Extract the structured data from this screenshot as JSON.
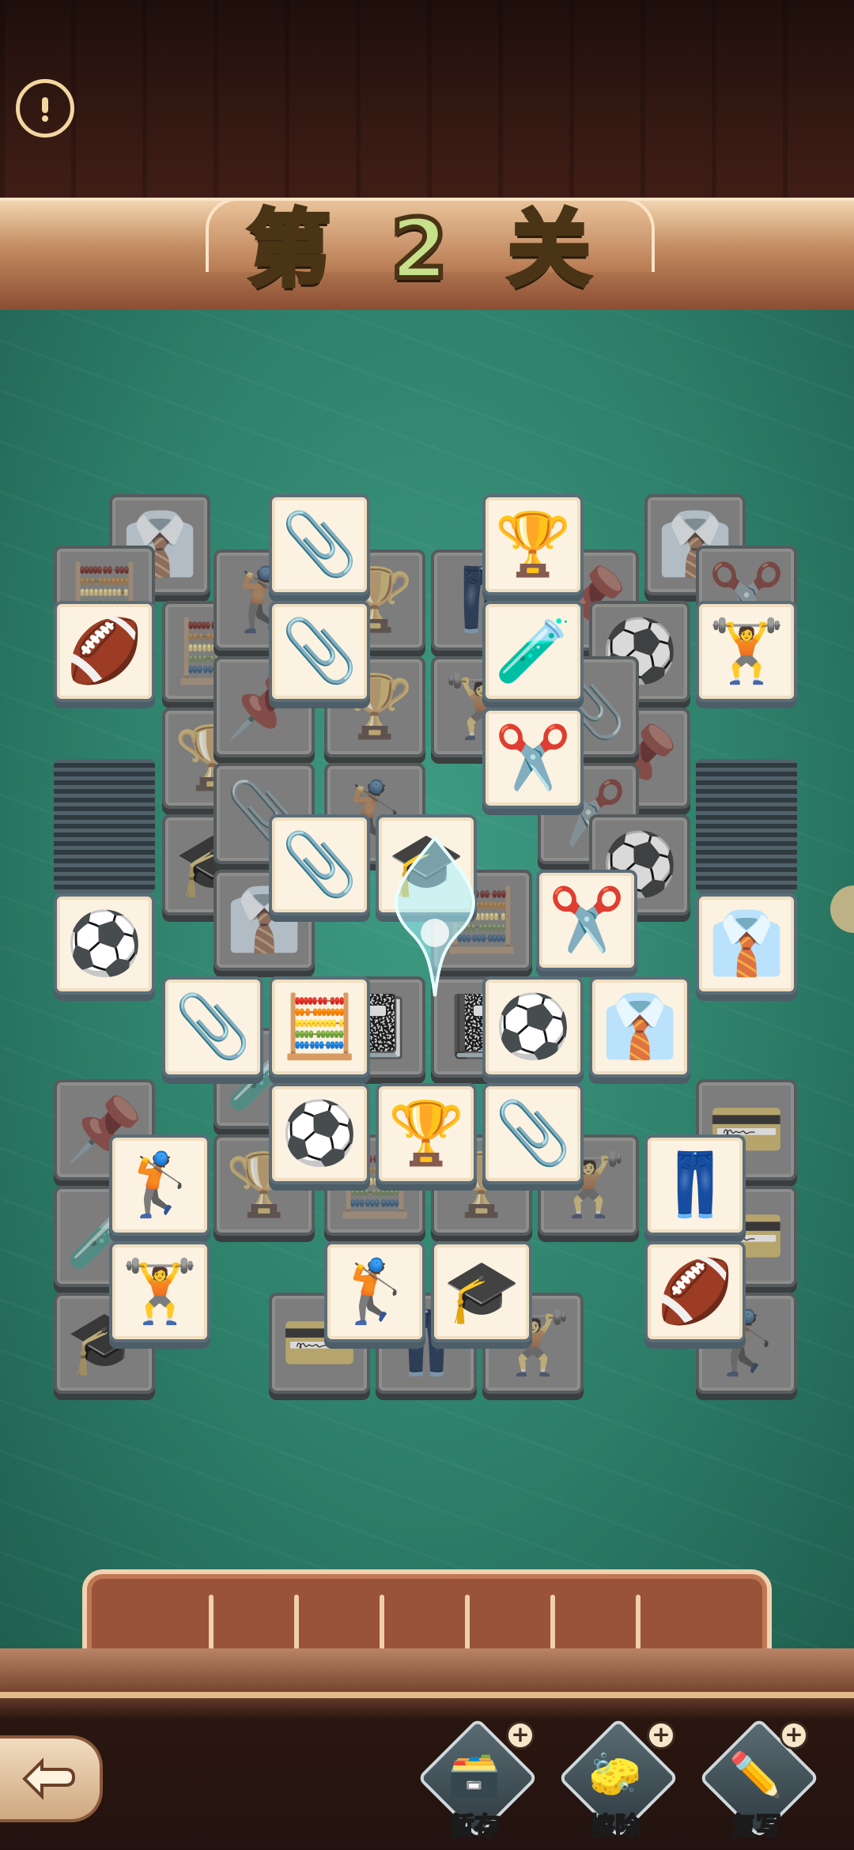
{
  "header": {
    "level_title": "第 2 关",
    "info_icon": "exclamation-circle-icon"
  },
  "tray": {
    "slot_count": 7
  },
  "toolbar": {
    "back_icon": "return-arrow-icon",
    "tools": [
      {
        "label": "暂存",
        "icon": "box-icon",
        "plus": "+"
      },
      {
        "label": "擦除",
        "icon": "eraser-icon",
        "plus": "+"
      },
      {
        "label": "复写",
        "icon": "pencil-icon",
        "plus": "+"
      }
    ]
  },
  "tiles": {
    "clip": "📎",
    "trophy": "🏆",
    "flask": "🧪",
    "scissors": "✂️",
    "football": "🏈",
    "dumbbell": "🏋️",
    "soccer": "⚽",
    "cap": "🎓",
    "shirt": "👔",
    "calculator": "🧮",
    "golf": "🏌️",
    "pants": "👖",
    "stapler": "📌",
    "notebook": "📓",
    "wallet": "💳"
  }
}
